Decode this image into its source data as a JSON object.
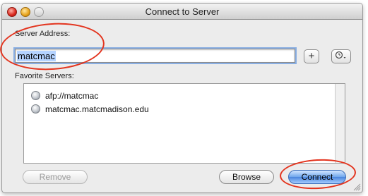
{
  "window": {
    "title": "Connect to Server"
  },
  "server_address": {
    "label": "Server Address:",
    "value": "matcmac",
    "add_label": "+",
    "recent_icon": "clock-icon"
  },
  "favorites": {
    "label": "Favorite Servers:",
    "items": [
      {
        "label": "afp://matcmac",
        "icon": "server-icon"
      },
      {
        "label": "matcmac.matcmadison.edu",
        "icon": "server-icon"
      }
    ]
  },
  "buttons": {
    "remove": "Remove",
    "browse": "Browse",
    "connect": "Connect"
  },
  "colors": {
    "annotation": "#e3341e",
    "connect_button": "#4a86dd",
    "selection": "#b5d3ff"
  }
}
